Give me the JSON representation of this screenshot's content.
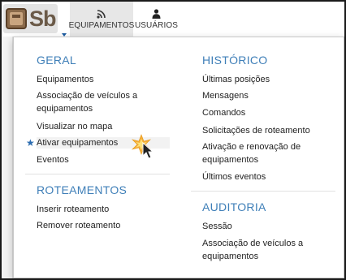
{
  "logo": {
    "text": "Sb"
  },
  "nav": {
    "equipamentos": {
      "label": "EQUIPAMENTOS",
      "icon": "rss-icon"
    },
    "usuarios": {
      "label": "USUÁRIOS",
      "icon": "user-icon"
    }
  },
  "menu": {
    "geral": {
      "title": "GERAL",
      "items": [
        {
          "label": "Equipamentos"
        },
        {
          "label": "Associação de veículos a"
        },
        {
          "label": "equipamentos"
        },
        {
          "label": "Visualizar no mapa"
        },
        {
          "label": "Ativar equipamentos"
        },
        {
          "label": "Eventos"
        }
      ]
    },
    "roteamentos": {
      "title": "ROTEAMENTOS",
      "items": [
        {
          "label": "Inserir roteamento"
        },
        {
          "label": "Remover roteamento"
        }
      ]
    },
    "historico": {
      "title": "HISTÓRICO",
      "items": [
        {
          "label": "Últimas posições"
        },
        {
          "label": "Mensagens"
        },
        {
          "label": "Comandos"
        },
        {
          "label": "Solicitações de roteamento"
        },
        {
          "label": "Ativação e renovação de"
        },
        {
          "label": "equipamentos"
        },
        {
          "label": "Últimos eventos"
        }
      ]
    },
    "auditoria": {
      "title": "AUDITORIA",
      "items": [
        {
          "label": "Sessão"
        },
        {
          "label": "Associação de veículos a"
        },
        {
          "label": "equipamentos"
        }
      ]
    }
  },
  "colors": {
    "section_title": "#3f7fb8",
    "star": "#2b6cb0",
    "nav_active_bg": "#e7e7e7"
  }
}
